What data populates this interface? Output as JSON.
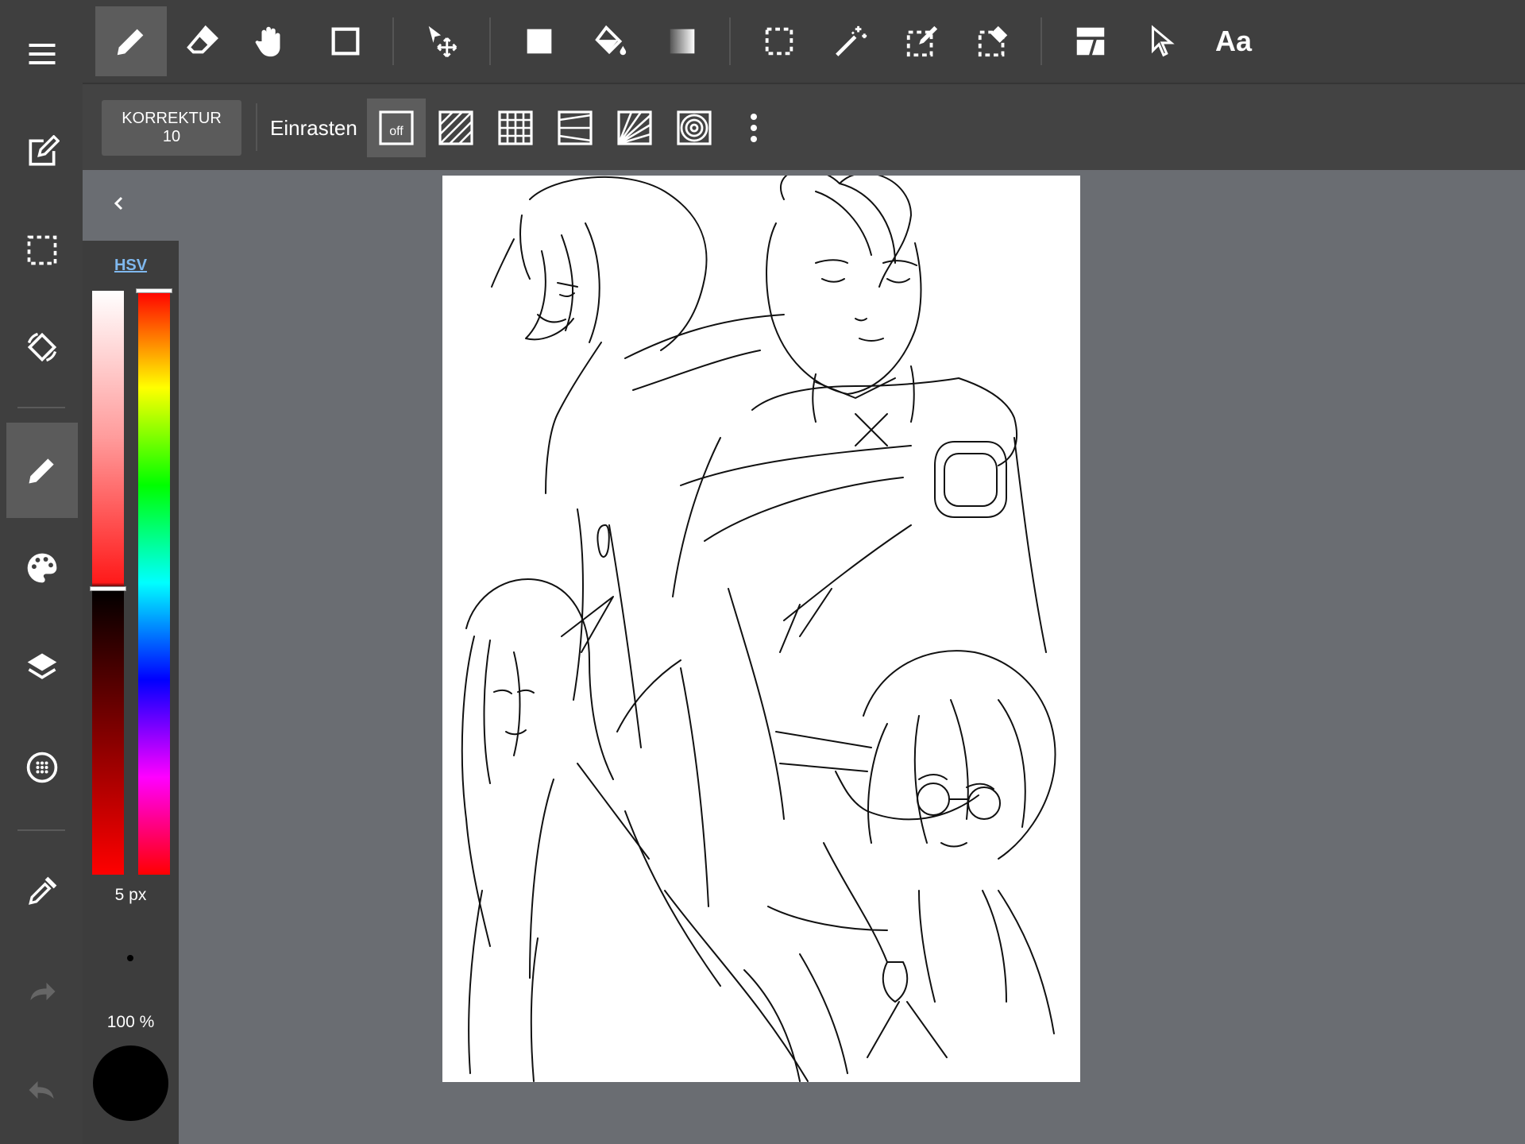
{
  "toolbar": {
    "tools": [
      "pen-tool",
      "eraser-tool",
      "hand-tool",
      "shape-tool",
      "move-tool",
      "fill-rect-tool",
      "bucket-tool",
      "gradient-tool",
      "select-tool",
      "magic-wand-tool",
      "select-pen-tool",
      "select-eraser-tool",
      "frame-divider-tool",
      "operation-tool",
      "text-tool"
    ],
    "active_tool": "pen-tool",
    "text_tool_label": "Aa"
  },
  "subbar": {
    "correction_label": "KORREKTUR",
    "correction_value": "10",
    "snap_label": "Einrasten",
    "snap_off_label": "off",
    "snap_options": [
      "snap-off",
      "parallel-snap",
      "grid-snap",
      "perspective-snap",
      "radial-snap",
      "circle-snap"
    ],
    "active_snap": "snap-off"
  },
  "leftnav": {
    "items": [
      "menu-icon",
      "edit-icon",
      "selection-icon",
      "rotate-icon",
      "pen-icon",
      "palette-icon",
      "layers-icon",
      "materials-icon",
      "eyedropper-icon",
      "redo-icon",
      "undo-icon"
    ],
    "active_item": "pen-icon"
  },
  "color_panel": {
    "mode_tab": "HSV",
    "brush_size": "5 px",
    "opacity": "100 %",
    "current_color": "#000000",
    "value_level": 0.51,
    "hue_level": 0.0
  },
  "colors": {
    "toolbar_bg": "#3f3f3f",
    "workspace_bg": "#6a6d72",
    "active_highlight": "#5c5c5c",
    "hsv_tab": "#7fb8ee"
  }
}
